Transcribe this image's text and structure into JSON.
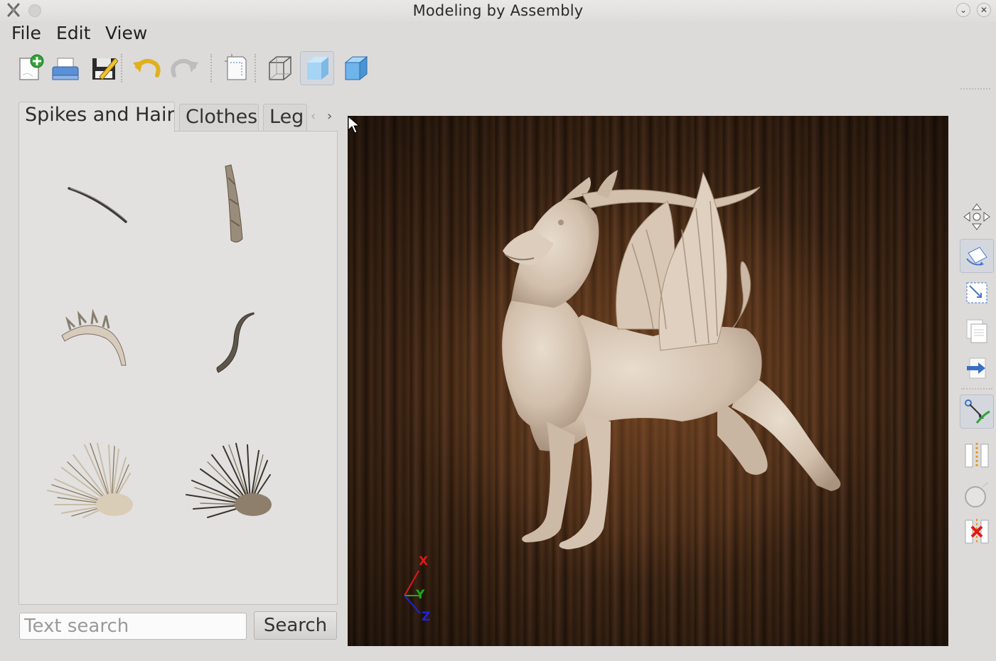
{
  "window": {
    "title": "Modeling by Assembly",
    "controls": {
      "minimize": "⌄",
      "close": "✕"
    }
  },
  "menu": {
    "file": "File",
    "edit": "Edit",
    "view": "View"
  },
  "toolbar": {
    "buttons": [
      "new-icon",
      "print-icon",
      "save-icon",
      "undo-icon",
      "redo-icon",
      "page-setup-icon",
      "wireframe-cube-icon",
      "shaded-cube-icon",
      "solid-cube-icon"
    ],
    "active": "shaded-cube-icon"
  },
  "tabs": {
    "items": [
      "Spikes and Hair",
      "Clothes",
      "Leg"
    ],
    "active": "Spikes and Hair",
    "scroll_left": "‹",
    "scroll_right": "›"
  },
  "parts": [
    "thin-spike",
    "twig",
    "ridged-horn",
    "curved-tail",
    "light-quills",
    "dark-quills"
  ],
  "search": {
    "placeholder": "Text search",
    "button": "Search"
  },
  "viewport": {
    "axes": {
      "x": "X",
      "y": "Y",
      "z": "Z"
    },
    "colors": {
      "x": "#e01818",
      "y": "#18b018",
      "z": "#2020e0",
      "model": "#d4c2b0"
    }
  },
  "side_toolbar": [
    "move-icon",
    "rotate-icon",
    "scale-icon",
    "copy-icon",
    "paste-icon",
    "connect-icon",
    "align-icon",
    "sphere-icon",
    "delete-icon"
  ]
}
